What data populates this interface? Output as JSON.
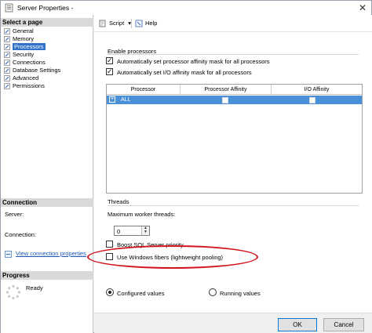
{
  "window": {
    "title": "Server Properties -",
    "close_glyph": "✕"
  },
  "select_page": {
    "header": "Select a page",
    "items": [
      {
        "label": "General",
        "selected": false
      },
      {
        "label": "Memory",
        "selected": false
      },
      {
        "label": "Processors",
        "selected": true
      },
      {
        "label": "Security",
        "selected": false
      },
      {
        "label": "Connections",
        "selected": false
      },
      {
        "label": "Database Settings",
        "selected": false
      },
      {
        "label": "Advanced",
        "selected": false
      },
      {
        "label": "Permissions",
        "selected": false
      }
    ],
    "item_icon": "page-wrench-icon"
  },
  "connection": {
    "header": "Connection",
    "server_label": "Server:",
    "server_value": "",
    "connection_label": "Connection:",
    "connection_value": "",
    "view_link": "View connection properties"
  },
  "progress": {
    "header": "Progress",
    "status": "Ready"
  },
  "toolbar": {
    "script_label": "Script",
    "help_label": "Help",
    "script_dropdown": "▾"
  },
  "enable_processors": {
    "title": "Enable processors",
    "affinity_mask": {
      "label": "Automatically set processor affinity mask for all processors",
      "checked": true
    },
    "io_affinity_mask": {
      "label": "Automatically set I/O affinity mask for all processors",
      "checked": true
    }
  },
  "grid": {
    "columns": [
      "Processor",
      "Processor Affinity",
      "I/O Affinity"
    ],
    "rows": [
      {
        "expander": "+",
        "processor": "ALL",
        "processor_affinity": false,
        "io_affinity": false
      }
    ]
  },
  "threads": {
    "title": "Threads",
    "max_worker_label": "Maximum worker threads:",
    "max_worker_value": "0",
    "boost_priority": {
      "label": "Boost SQL Server priority",
      "checked": false
    },
    "windows_fibers": {
      "label": "Use Windows fibers (lightweight pooling)",
      "checked": false
    }
  },
  "values_mode": {
    "configured": "Configured values",
    "running": "Running values",
    "selected": "configured"
  },
  "buttons": {
    "ok": "OK",
    "cancel": "Cancel"
  },
  "colors": {
    "selection": "#3073c9",
    "highlight_ellipse": "#d0161d",
    "grid_row": "#4a90d9",
    "link": "#1a56b5"
  }
}
